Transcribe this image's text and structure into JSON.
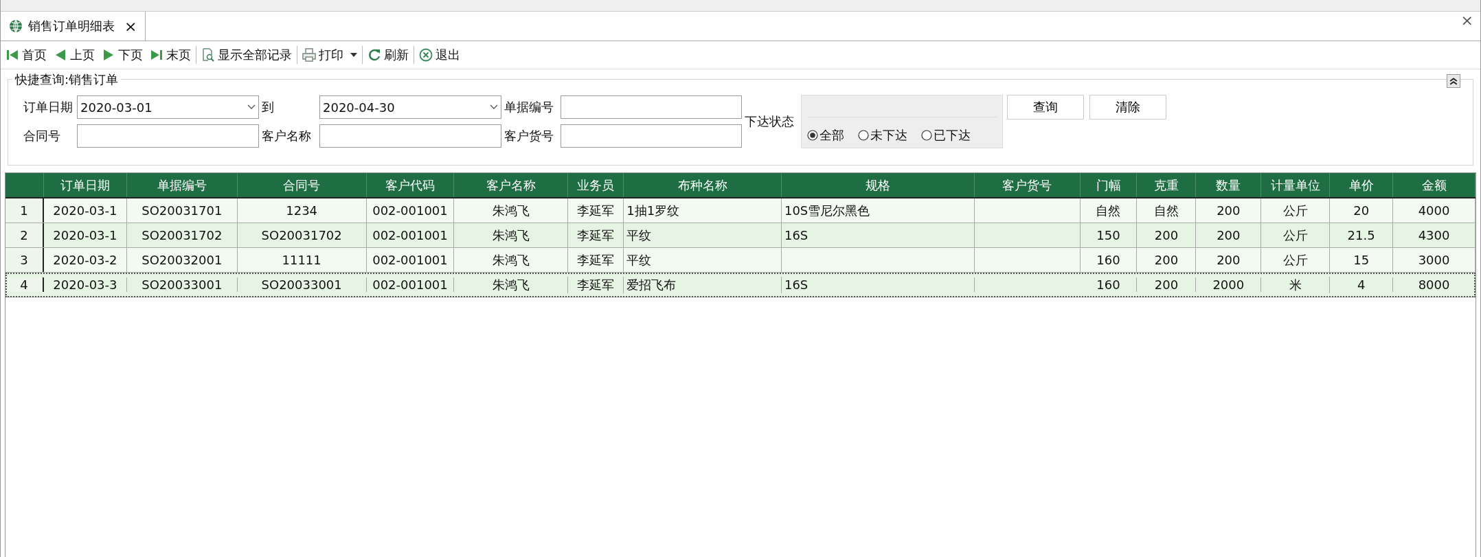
{
  "tab": {
    "title": "销售订单明细表",
    "close": "×"
  },
  "window_close": "×",
  "toolbar": [
    {
      "kind": "first",
      "label": "首页"
    },
    {
      "kind": "prev",
      "label": "上页"
    },
    {
      "kind": "next",
      "label": "下页"
    },
    {
      "kind": "last",
      "label": "末页"
    },
    {
      "kind": "showall",
      "label": "显示全部记录"
    },
    {
      "kind": "print",
      "label": "打印"
    },
    {
      "kind": "refresh",
      "label": "刷新"
    },
    {
      "kind": "exit",
      "label": "退出"
    }
  ],
  "query": {
    "title": "快捷查询:销售订单",
    "date_label": "订单日期",
    "date_from": "2020-03-01",
    "to_label": "到",
    "date_to": "2020-04-30",
    "doc_no_label": "单据编号",
    "contract_label": "合同号",
    "customer_name_label": "客户名称",
    "customer_item_label": "客户货号",
    "status_label": "下达状态",
    "status_options": [
      {
        "label": "全部",
        "selected": true
      },
      {
        "label": "未下达",
        "selected": false
      },
      {
        "label": "已下达",
        "selected": false
      }
    ],
    "buttons": [
      "查询",
      "清除"
    ]
  },
  "table": {
    "columns": [
      "订单日期",
      "单据编号",
      "合同号",
      "客户代码",
      "客户名称",
      "业务员",
      "布种名称",
      "规格",
      "客户货号",
      "门幅",
      "克重",
      "数量",
      "计量单位",
      "单价",
      "金额"
    ],
    "rows": [
      {
        "num": "1",
        "selected": false,
        "cells": [
          "2020-03-1",
          "SO20031701",
          "1234",
          "002-001001",
          "朱鸿飞",
          "李延军",
          "1抽1罗纹",
          "10S雪尼尔黑色",
          "",
          "自然",
          "自然",
          "200",
          "公斤",
          "20",
          "4000"
        ]
      },
      {
        "num": "2",
        "selected": false,
        "cells": [
          "2020-03-1",
          "SO20031702",
          "SO20031702",
          "002-001001",
          "朱鸿飞",
          "李延军",
          "平纹",
          "16S",
          "",
          "150",
          "200",
          "200",
          "公斤",
          "21.5",
          "4300"
        ]
      },
      {
        "num": "3",
        "selected": false,
        "cells": [
          "2020-03-2",
          "SO20032001",
          "11111",
          "002-001001",
          "朱鸿飞",
          "李延军",
          "平纹",
          "",
          "",
          "160",
          "200",
          "200",
          "公斤",
          "15",
          "3000"
        ]
      },
      {
        "num": "4",
        "selected": true,
        "cells": [
          "2020-03-3",
          "SO20033001",
          "SO20033001",
          "002-001001",
          "朱鸿飞",
          "李延军",
          "爱招飞布",
          "16S",
          "",
          "160",
          "200",
          "2000",
          "米",
          "4",
          "8000"
        ]
      }
    ]
  }
}
